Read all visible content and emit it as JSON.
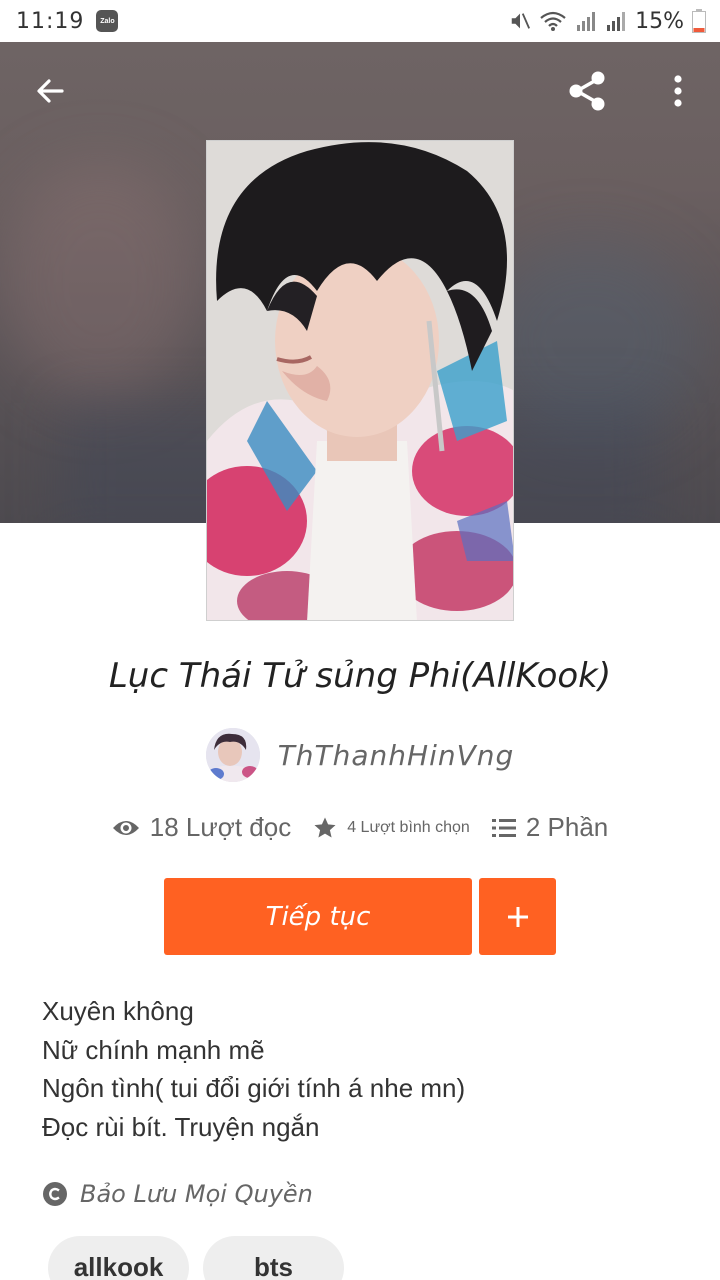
{
  "status_bar": {
    "time": "11:19",
    "notification_app": "Zalo",
    "battery_percent": "15%",
    "icons": [
      "mute-icon",
      "wifi-icon",
      "signal-icon",
      "signal-icon",
      "battery-icon"
    ]
  },
  "header": {
    "back_icon": "arrow-left-icon",
    "share_icon": "share-icon",
    "more_icon": "more-vertical-icon"
  },
  "story": {
    "title": "Lục Thái Tử sủng Phi(AllKook)",
    "author": "ThThanhHinVng",
    "stats": {
      "reads": "18 Lượt đọc",
      "votes": "4 Lượt bình chọn",
      "parts": "2 Phần"
    },
    "continue_label": "Tiếp tục",
    "add_label": "+",
    "description": [
      "Xuyên không",
      "Nữ chính mạnh mẽ",
      "Ngôn tình( tui đổi giới tính á nhe mn)",
      "Đọc rùi bít. Truyện ngắn"
    ],
    "copyright": "Bảo Lưu Mọi Quyền",
    "tags": [
      "allkook",
      "bts"
    ]
  },
  "colors": {
    "accent": "#ff6122",
    "text_primary": "#222222",
    "text_secondary": "#666666",
    "tag_background": "#eeeeee"
  }
}
